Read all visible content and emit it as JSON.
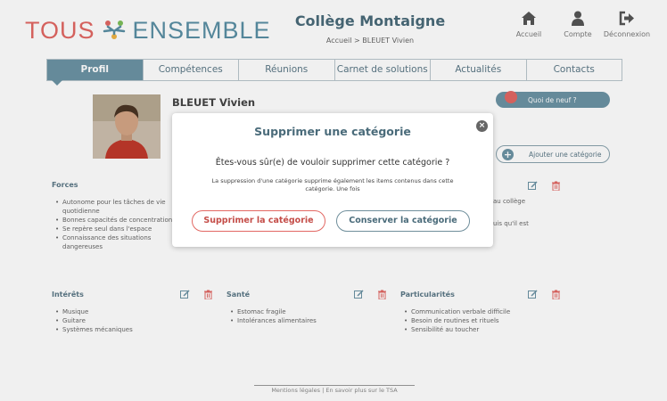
{
  "header": {
    "logo_word1": "TOUS",
    "logo_word2": "ENSEMBLE",
    "school_name": "Collège Montaigne",
    "breadcrumb": "Accueil > BLEUET Vivien",
    "nav": [
      {
        "label": "Accueil",
        "icon": "home-icon"
      },
      {
        "label": "Compte",
        "icon": "user-icon"
      },
      {
        "label": "Déconnexion",
        "icon": "logout-icon"
      }
    ]
  },
  "tabs": [
    "Profil",
    "Compétences",
    "Réunions",
    "Carnet de solutions",
    "Actualités",
    "Contacts"
  ],
  "active_tab": "Profil",
  "profile": {
    "name": "BLEUET Vivien",
    "news_button": "Quoi de neuf ?",
    "add_category_button": "Ajouter une catégorie"
  },
  "sections": {
    "forces": {
      "title": "Forces",
      "items": [
        "Autonome pour les tâches de vie quotidienne",
        "Bonnes capacités de concentration",
        "Se repère seul dans l'espace",
        "Connaissance des situations dangereuses"
      ],
      "right_snippets": [
        "au collège",
        "uis qu'il est"
      ]
    },
    "interets": {
      "title": "Intérêts",
      "items": [
        "Musique",
        "Guitare",
        "Systèmes mécaniques"
      ]
    },
    "sante": {
      "title": "Santé",
      "items": [
        "Estomac fragile",
        "Intolérances alimentaires"
      ]
    },
    "particularites": {
      "title": "Particularités",
      "items": [
        "Communication verbale difficile",
        "Besoin de routines et rituels",
        "Sensibilité au toucher"
      ]
    }
  },
  "footer": "Mentions légales  |  En savoir plus sur le TSA",
  "modal": {
    "title": "Supprimer une catégorie",
    "question": "Êtes-vous sûr(e) de vouloir supprimer cette catégorie ?",
    "description": "La suppression d'une catégorie supprime également les items contenus dans cette catégorie. Une fois",
    "delete_button": "Supprimer la catégorie",
    "keep_button": "Conserver la catégorie",
    "close_symbol": "×"
  },
  "colors": {
    "accent": "#6c93a4",
    "brand_red": "#e26863",
    "brand_blue": "#5a8fa4"
  }
}
